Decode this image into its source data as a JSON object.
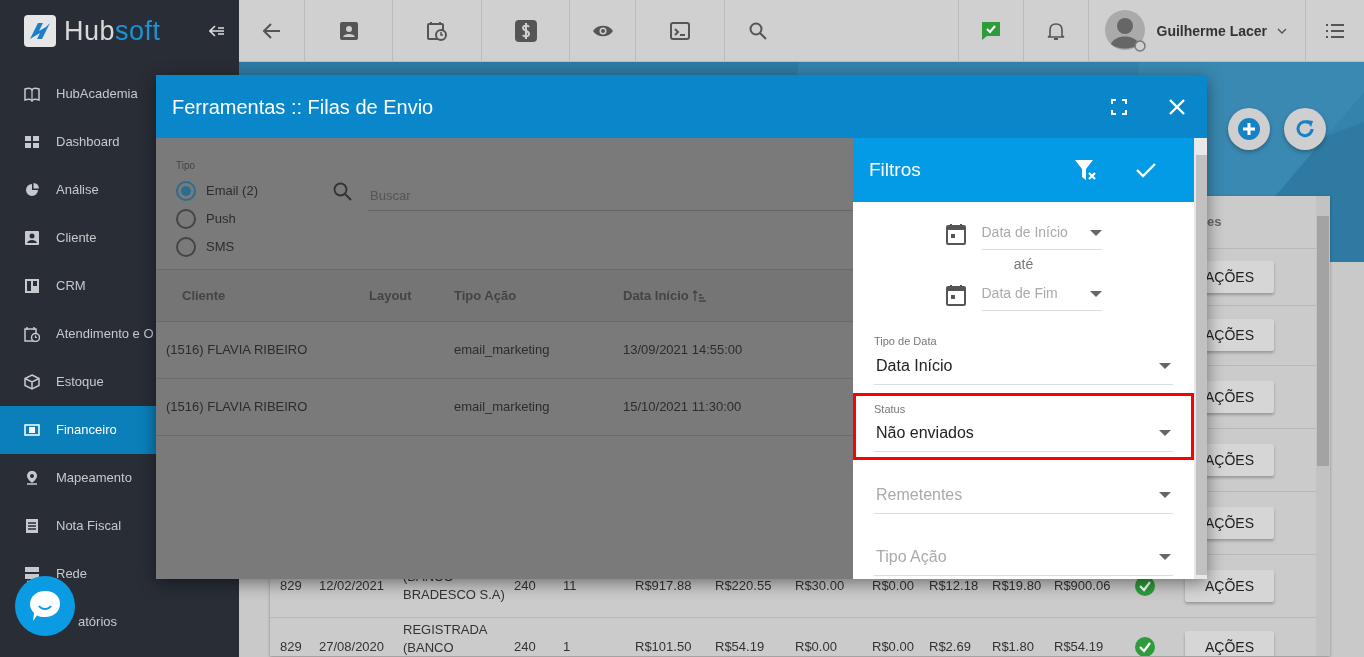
{
  "logo": {
    "primary": "Hub",
    "accent": "soft"
  },
  "sidebar": {
    "items": [
      {
        "label": "HubAcademia",
        "selected": false
      },
      {
        "label": "Dashboard",
        "selected": false
      },
      {
        "label": "Análise",
        "selected": false
      },
      {
        "label": "Cliente",
        "selected": false
      },
      {
        "label": "CRM",
        "selected": false
      },
      {
        "label": "Atendimento e O",
        "selected": false
      },
      {
        "label": "Estoque",
        "selected": false
      },
      {
        "label": "Financeiro",
        "selected": true
      },
      {
        "label": "Mapeamento",
        "selected": false
      },
      {
        "label": "Nota Fiscal",
        "selected": false
      },
      {
        "label": "Rede",
        "selected": false
      },
      {
        "label": "atórios",
        "selected": false
      }
    ]
  },
  "topbar": {
    "user": {
      "name": "Guilherme Lacer"
    }
  },
  "page": {
    "table": {
      "header_fragment": "es",
      "rows": [
        {
          "action": "AÇÕES"
        },
        {
          "action": "AÇÕES"
        },
        {
          "action": "AÇÕES"
        },
        {
          "action": "AÇÕES"
        },
        {
          "action": "AÇÕES"
        },
        {
          "cells": [
            "829",
            "12/02/2021",
            "(BANCO BRADESCO S.A)",
            "240",
            "11",
            "R$917.88",
            "R$220.55",
            "R$30.00",
            "R$0.00",
            "R$12.18",
            "R$19.80",
            "R$900.06"
          ],
          "confirmed": true,
          "action": "AÇÕES"
        },
        {
          "cells": [
            "829",
            "27/08/2020",
            "REGISTRADA (BANCO",
            "240",
            "1",
            "R$101.50",
            "R$54.19",
            "R$0.00",
            "R$0.00",
            "R$2.69",
            "R$1.80",
            "R$54.19"
          ],
          "confirmed": true,
          "action": "AÇÕES"
        }
      ]
    }
  },
  "modal": {
    "title": "Ferramentas :: Filas de Envio",
    "type_label": "Tipo",
    "types": [
      {
        "label": "Email (2)",
        "selected": true
      },
      {
        "label": "Push",
        "selected": false
      },
      {
        "label": "SMS",
        "selected": false
      }
    ],
    "search": {
      "placeholder": "Buscar"
    },
    "table": {
      "columns": [
        {
          "label": "Cliente",
          "sorted": false
        },
        {
          "label": "Layout",
          "sorted": false
        },
        {
          "label": "Tipo Ação",
          "sorted": false
        },
        {
          "label": "Data Início",
          "sorted": true
        }
      ],
      "rows": [
        {
          "cliente": "(1516) FLAVIA RIBEIRO",
          "tipo_acao": "email_marketing",
          "data_inicio": "13/09/2021 14:55:00"
        },
        {
          "cliente": "(1516) FLAVIA RIBEIRO",
          "tipo_acao": "email_marketing",
          "data_inicio": "15/10/2021 11:30:00"
        }
      ]
    },
    "filters": {
      "title": "Filtros",
      "date_start": {
        "placeholder": "Data de Início"
      },
      "separator": "até",
      "date_end": {
        "placeholder": "Data de Fim"
      },
      "fields": [
        {
          "label": "Tipo de Data",
          "value": "Data Início",
          "highlighted": false
        },
        {
          "label": "Status",
          "value": "Não enviados",
          "highlighted": true
        },
        {
          "placeholder": "Remetentes",
          "highlighted": false
        },
        {
          "placeholder": "Tipo Ação",
          "highlighted": false
        }
      ]
    }
  }
}
